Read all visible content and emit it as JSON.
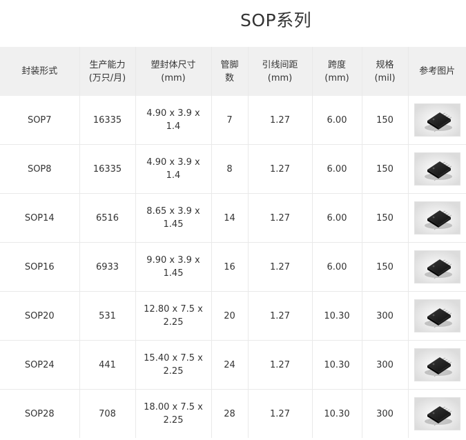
{
  "page": {
    "title": "SOP系列"
  },
  "table": {
    "headers": [
      [
        "封装形式"
      ],
      [
        "生产能力",
        "(万只/月)"
      ],
      [
        "塑封体尺寸",
        "(mm)"
      ],
      [
        "管脚",
        "数"
      ],
      [
        "引线间距",
        "(mm)"
      ],
      [
        "跨度",
        "(mm)"
      ],
      [
        "规格",
        "(mil)"
      ],
      [
        "参考图片"
      ]
    ],
    "rows": [
      {
        "package": "SOP7",
        "capacity": "16335",
        "size": [
          "4.90 x 3.9 x",
          "1.4"
        ],
        "pins": "7",
        "pitch": "1.27",
        "span": "6.00",
        "spec": "150",
        "image_icon": "sop-chip-icon"
      },
      {
        "package": "SOP8",
        "capacity": "16335",
        "size": [
          "4.90 x 3.9 x",
          "1.4"
        ],
        "pins": "8",
        "pitch": "1.27",
        "span": "6.00",
        "spec": "150",
        "image_icon": "sop-chip-icon"
      },
      {
        "package": "SOP14",
        "capacity": "6516",
        "size": [
          "8.65 x 3.9 x",
          "1.45"
        ],
        "pins": "14",
        "pitch": "1.27",
        "span": "6.00",
        "spec": "150",
        "image_icon": "sop-chip-icon"
      },
      {
        "package": "SOP16",
        "capacity": "6933",
        "size": [
          "9.90 x 3.9 x",
          "1.45"
        ],
        "pins": "16",
        "pitch": "1.27",
        "span": "6.00",
        "spec": "150",
        "image_icon": "sop-chip-icon"
      },
      {
        "package": "SOP20",
        "capacity": "531",
        "size": [
          "12.80 x 7.5 x",
          "2.25"
        ],
        "pins": "20",
        "pitch": "1.27",
        "span": "10.30",
        "spec": "300",
        "image_icon": "sop-chip-icon"
      },
      {
        "package": "SOP24",
        "capacity": "441",
        "size": [
          "15.40 x 7.5 x",
          "2.25"
        ],
        "pins": "24",
        "pitch": "1.27",
        "span": "10.30",
        "spec": "300",
        "image_icon": "sop-chip-icon"
      },
      {
        "package": "SOP28",
        "capacity": "708",
        "size": [
          "18.00 x 7.5 x",
          "2.25"
        ],
        "pins": "28",
        "pitch": "1.27",
        "span": "10.30",
        "spec": "300",
        "image_icon": "sop-chip-icon"
      }
    ]
  },
  "colors": {
    "header_bg": "#f0f0f0",
    "text": "#333333",
    "border": "#e9e9e9",
    "chip_body": "#1a1a1a"
  }
}
